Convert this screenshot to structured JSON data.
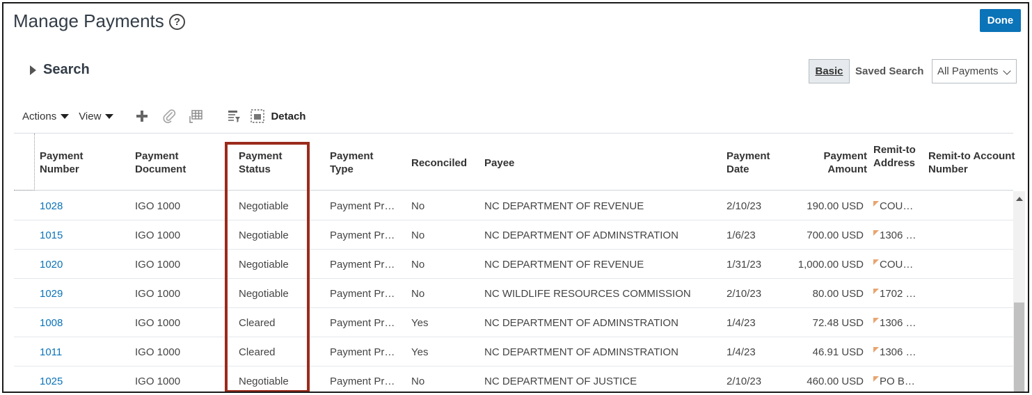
{
  "header": {
    "title": "Manage Payments",
    "help_glyph": "?",
    "done_label": "Done"
  },
  "search": {
    "label": "Search",
    "basic_label": "Basic",
    "saved_search_label": "Saved Search",
    "saved_search_value": "All Payments"
  },
  "toolbar": {
    "actions_label": "Actions",
    "view_label": "View",
    "detach_label": "Detach",
    "icons": [
      "add-icon",
      "attachment-icon",
      "freeze-column-icon",
      "query-by-example-icon",
      "detach-icon"
    ]
  },
  "table": {
    "columns": [
      "Payment Number",
      "Payment Document",
      "Payment Status",
      "Payment Type",
      "Reconciled",
      "Payee",
      "Payment Date",
      "Payment Amount",
      "Remit-to Address",
      "Remit-to Account Number"
    ],
    "rows": [
      {
        "number": "1028",
        "document": "IGO 1000",
        "status": "Negotiable",
        "type": "Payment Pr…",
        "reconciled": "No",
        "payee": "NC DEPARTMENT OF REVENUE",
        "date": "2/10/23",
        "amount": "190.00 USD",
        "remit": "COU…"
      },
      {
        "number": "1015",
        "document": "IGO 1000",
        "status": "Negotiable",
        "type": "Payment Pr…",
        "reconciled": "No",
        "payee": "NC DEPARTMENT OF ADMINSTRATION",
        "date": "1/6/23",
        "amount": "700.00 USD",
        "remit": "1306 …"
      },
      {
        "number": "1020",
        "document": "IGO 1000",
        "status": "Negotiable",
        "type": "Payment Pr…",
        "reconciled": "No",
        "payee": "NC DEPARTMENT OF REVENUE",
        "date": "1/31/23",
        "amount": "1,000.00 USD",
        "remit": "COU…"
      },
      {
        "number": "1029",
        "document": "IGO 1000",
        "status": "Negotiable",
        "type": "Payment Pr…",
        "reconciled": "No",
        "payee": "NC WILDLIFE RESOURCES COMMISSION",
        "date": "2/10/23",
        "amount": "80.00 USD",
        "remit": "1702 …"
      },
      {
        "number": "1008",
        "document": "IGO 1000",
        "status": "Cleared",
        "type": "Payment Pr…",
        "reconciled": "Yes",
        "payee": "NC DEPARTMENT OF ADMINSTRATION",
        "date": "1/4/23",
        "amount": "72.48 USD",
        "remit": "1306 …"
      },
      {
        "number": "1011",
        "document": "IGO 1000",
        "status": "Cleared",
        "type": "Payment Pr…",
        "reconciled": "Yes",
        "payee": "NC DEPARTMENT OF ADMINSTRATION",
        "date": "1/4/23",
        "amount": "46.91 USD",
        "remit": "1306 …"
      },
      {
        "number": "1025",
        "document": "IGO 1000",
        "status": "Negotiable",
        "type": "Payment Pr…",
        "reconciled": "No",
        "payee": "NC DEPARTMENT OF JUSTICE",
        "date": "2/10/23",
        "amount": "460.00 USD",
        "remit": "PO B…"
      }
    ]
  },
  "colors": {
    "accent": "#0b73b8",
    "highlight": "#9b2b1b",
    "remit_flag": "#e8a470"
  }
}
